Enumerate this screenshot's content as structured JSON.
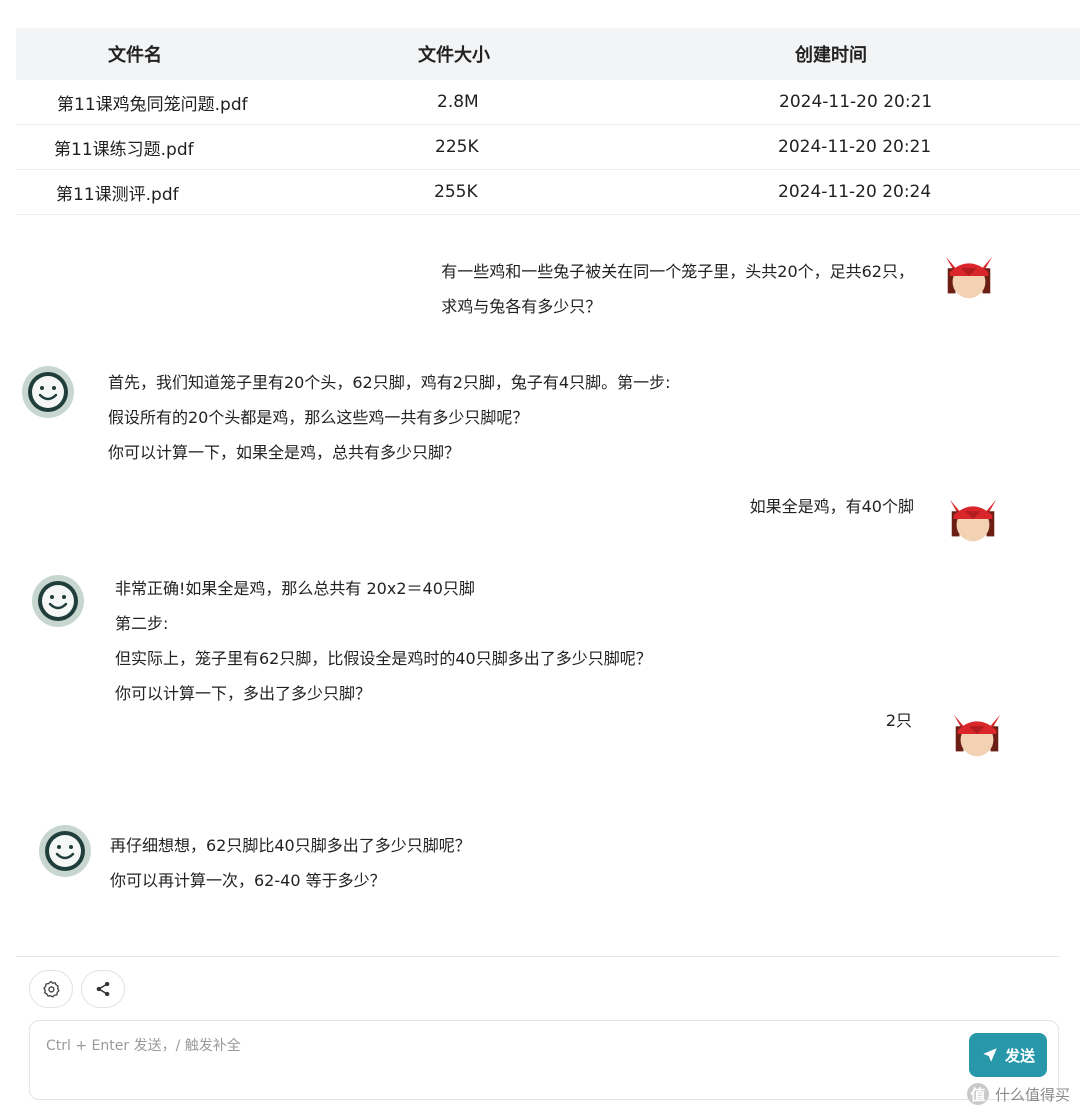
{
  "file_table": {
    "headers": {
      "name": "文件名",
      "size": "文件大小",
      "created": "创建时间"
    },
    "rows": [
      {
        "name": "第11课鸡兔同笼问题.pdf",
        "size": "2.8M",
        "created": "2024-11-20 20:21"
      },
      {
        "name": "第11课练习题.pdf",
        "size": "225K",
        "created": "2024-11-20 20:21"
      },
      {
        "name": "第11课测评.pdf",
        "size": "255K",
        "created": "2024-11-20 20:24"
      }
    ]
  },
  "chat": {
    "messages": [
      {
        "role": "user",
        "lines": [
          "有一些鸡和一些兔子被关在同一个笼子里，头共20个，足共62只，",
          "求鸡与兔各有多少只？"
        ]
      },
      {
        "role": "assistant",
        "lines": [
          "首先，我们知道笼子里有20个头，62只脚，鸡有2只脚，兔子有4只脚。第一步:",
          "假设所有的20个头都是鸡，那么这些鸡一共有多少只脚呢？",
          "你可以计算一下，如果全是鸡，总共有多少只脚？"
        ]
      },
      {
        "role": "user",
        "lines": [
          "如果全是鸡，有40个脚"
        ]
      },
      {
        "role": "assistant",
        "lines": [
          "非常正确!如果全是鸡，那么总共有 20x2＝40只脚",
          "第二步:",
          "但实际上，笼子里有62只脚，比假设全是鸡时的40只脚多出了多少只脚呢？",
          "你可以计算一下，多出了多少只脚？"
        ]
      },
      {
        "role": "user",
        "lines": [
          "2只"
        ]
      },
      {
        "role": "assistant",
        "lines": [
          "再仔细想想，62只脚比40只脚多出了多少只脚呢？",
          "你可以再计算一次，62-40 等于多少？"
        ]
      }
    ]
  },
  "input": {
    "placeholder": "Ctrl + Enter 发送，/ 触发补全",
    "send_label": "发送"
  },
  "toolbar": {
    "settings_icon": "gear-icon",
    "share_icon": "share-icon"
  },
  "watermark": {
    "logo": "值",
    "text": "什么值得买"
  },
  "colors": {
    "accent": "#2897a9",
    "header_bg": "#f3f4f5",
    "user_avatar_red": "#d9262b",
    "bot_avatar_bg": "#c8d6d0"
  }
}
